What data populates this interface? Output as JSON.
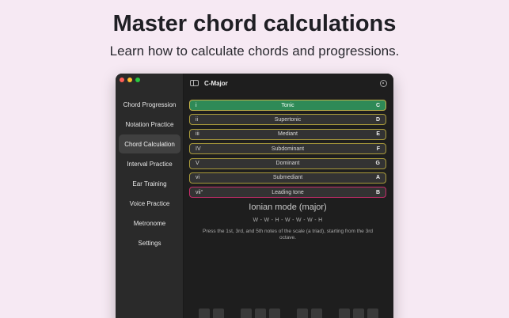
{
  "marketing": {
    "headline": "Master chord calculations",
    "subheadline": "Learn how to calculate chords and progressions."
  },
  "window": {
    "title": "C-Major"
  },
  "sidebar": {
    "items": [
      {
        "label": "Chord Progression",
        "active": false
      },
      {
        "label": "Notation Practice",
        "active": false
      },
      {
        "label": "Chord Calculation",
        "active": true
      },
      {
        "label": "Interval Practice",
        "active": false
      },
      {
        "label": "Ear Training",
        "active": false
      },
      {
        "label": "Voice Practice",
        "active": false
      },
      {
        "label": "Metronome",
        "active": false
      },
      {
        "label": "Settings",
        "active": false
      }
    ]
  },
  "degrees": [
    {
      "roman": "i",
      "name": "Tonic",
      "note": "C"
    },
    {
      "roman": "ii",
      "name": "Supertonic",
      "note": "D"
    },
    {
      "roman": "iii",
      "name": "Mediant",
      "note": "E"
    },
    {
      "roman": "IV",
      "name": "Subdominant",
      "note": "F"
    },
    {
      "roman": "V",
      "name": "Dominant",
      "note": "G"
    },
    {
      "roman": "vi",
      "name": "Submediant",
      "note": "A"
    },
    {
      "roman": "vii°",
      "name": "Leading tone",
      "note": "B"
    }
  ],
  "mode": {
    "title": "Ionian mode (major)",
    "pattern": "W - W - H - W - W - W - H",
    "instructions": "Press the 1st, 3rd, and 5th notes of the scale (a triad), starting from the 3rd octave."
  },
  "colors": {
    "background": "#f6e9f3",
    "selected_row": "#2e8a57",
    "row_border": "#a99a3b",
    "leading_tone_border": "#c72c6a"
  }
}
